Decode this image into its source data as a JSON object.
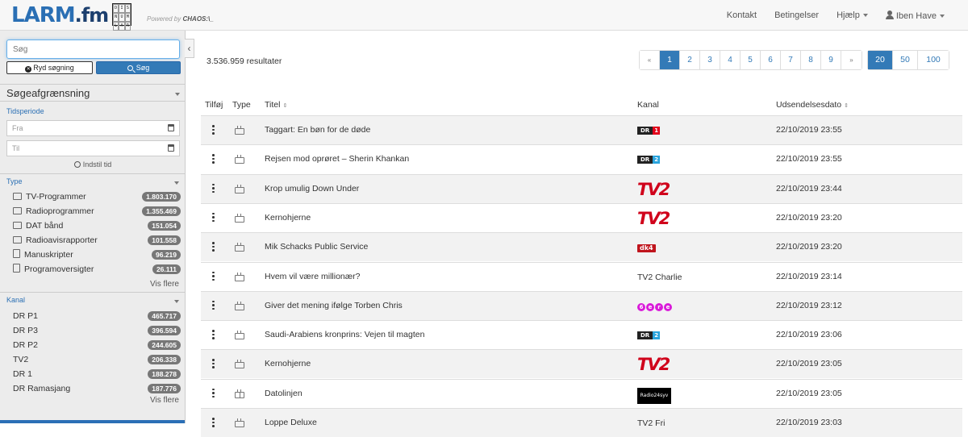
{
  "app": {
    "logo_text": "LARM",
    "logo_suffix": ".fm",
    "partner_grid": [
      "DIS",
      "NUM",
      "LAR"
    ],
    "powered_prefix": "Powered by",
    "powered_brand": "CHAOS:\\_"
  },
  "nav": {
    "kontakt": "Kontakt",
    "betingelser": "Betingelser",
    "hjaelp": "Hjælp",
    "user": "Iben Have"
  },
  "sidebar": {
    "search_placeholder": "Søg",
    "clear_label": "Ryd søgning",
    "search_label": "Søg",
    "facet_heading": "Søgeafgrænsning",
    "tidsperiode": {
      "title": "Tidsperiode",
      "from_placeholder": "Fra",
      "to_placeholder": "Til",
      "set_time": "Indstil tid"
    },
    "type": {
      "title": "Type",
      "items": [
        {
          "label": "TV-Programmer",
          "count": "1.803.170",
          "icon": "tv-icon"
        },
        {
          "label": "Radioprogrammer",
          "count": "1.355.469",
          "icon": "radio-icon"
        },
        {
          "label": "DAT bånd",
          "count": "151.054",
          "icon": "tape-icon"
        },
        {
          "label": "Radioavisrapporter",
          "count": "101.558",
          "icon": "news-icon"
        },
        {
          "label": "Manuskripter",
          "count": "96.219",
          "icon": "document-icon"
        },
        {
          "label": "Programoversigter",
          "count": "26.111",
          "icon": "list-document-icon"
        }
      ],
      "more": "Vis flere"
    },
    "kanal": {
      "title": "Kanal",
      "items": [
        {
          "label": "DR P1",
          "count": "465.717"
        },
        {
          "label": "DR P3",
          "count": "396.594"
        },
        {
          "label": "DR P2",
          "count": "244.605"
        },
        {
          "label": "TV2",
          "count": "206.338"
        },
        {
          "label": "DR 1",
          "count": "188.278"
        },
        {
          "label": "DR Ramasjang",
          "count": "187.776"
        }
      ],
      "more": "Vis flere"
    }
  },
  "main": {
    "results": "3.536.959 resultater",
    "pagination": [
      "«",
      "1",
      "2",
      "3",
      "4",
      "5",
      "6",
      "7",
      "8",
      "9",
      "»"
    ],
    "active_page": "1",
    "per_page": [
      "20",
      "50",
      "100"
    ],
    "active_per_page": "20",
    "columns": {
      "tilfoj": "Tilføj",
      "type": "Type",
      "titel": "Titel",
      "kanal": "Kanal",
      "dato": "Udsendelsesdato"
    },
    "rows": [
      {
        "title": "Taggart: En bøn for de døde",
        "kanal": "DR1",
        "kanal_logo": "dr",
        "date": "22/10/2019 23:55",
        "type": "tv"
      },
      {
        "title": "Rejsen mod oprøret – Sherin Khankan",
        "kanal": "DR2",
        "kanal_logo": "dr",
        "date": "22/10/2019 23:55",
        "type": "tv"
      },
      {
        "title": "Krop umulig Down Under",
        "kanal": "TV2",
        "kanal_logo": "tv2",
        "date": "22/10/2019 23:44",
        "type": "tv"
      },
      {
        "title": "Kernohjerne",
        "kanal": "TV2",
        "kanal_logo": "tv2",
        "date": "22/10/2019 23:20",
        "type": "tv"
      },
      {
        "title": "Mik Schacks Public Service",
        "kanal": "dk4",
        "kanal_logo": "dk4",
        "date": "22/10/2019 23:20",
        "type": "tv"
      },
      {
        "title": "Hvem vil være millionær?",
        "kanal": "TV2 Charlie",
        "kanal_logo": "text",
        "date": "22/10/2019 23:14",
        "type": "tv"
      },
      {
        "title": "Giver det mening ifølge Torben Chris",
        "kanal": "6eren",
        "kanal_logo": "6eren",
        "date": "22/10/2019 23:12",
        "type": "tv"
      },
      {
        "title": "Saudi-Arabiens kronprins: Vejen til magten",
        "kanal": "DR2",
        "kanal_logo": "dr",
        "date": "22/10/2019 23:06",
        "type": "tv"
      },
      {
        "title": "Kernohjerne",
        "kanal": "TV2",
        "kanal_logo": "tv2",
        "date": "22/10/2019 23:05",
        "type": "tv"
      },
      {
        "title": "Datolinjen",
        "kanal": "Radio24syv",
        "kanal_logo": "r24",
        "date": "22/10/2019 23:05",
        "type": "radio"
      },
      {
        "title": "Loppe Deluxe",
        "kanal": "TV2 Fri",
        "kanal_logo": "text",
        "date": "22/10/2019 23:03",
        "type": "tv"
      }
    ]
  },
  "colors": {
    "primary": "#337ab7",
    "dr1": "#e2001a",
    "dr2": "#2aa4dd",
    "tv2": "#d0021b",
    "badge": "#777777"
  }
}
